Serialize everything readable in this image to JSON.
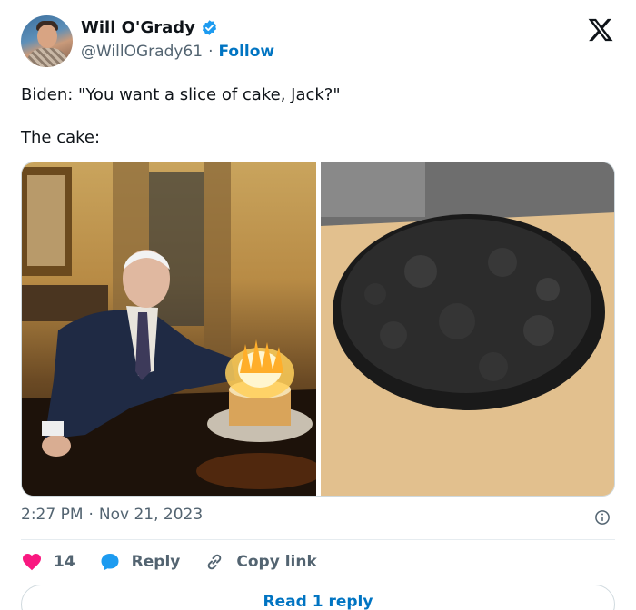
{
  "author": {
    "name": "Will O'Grady",
    "handle": "@WillOGrady61",
    "separator": "·",
    "follow_label": "Follow",
    "verified": true,
    "avatar_icon": "profile-photo"
  },
  "platform_icon": "x-logo-icon",
  "tweet": {
    "line1": "Biden: \"You want a slice of cake, Jack?\"",
    "line2": "The cake:"
  },
  "media": {
    "left_image": "photo-man-with-flaming-cake",
    "right_image": "photo-burnt-pizza"
  },
  "meta": {
    "time": "2:27 PM",
    "separator": "·",
    "date": "Nov 21, 2023",
    "info_icon": "info-icon"
  },
  "actions": {
    "like_count": "14",
    "reply_label": "Reply",
    "copy_label": "Copy link"
  },
  "read_replies_label": "Read 1 reply",
  "colors": {
    "text": "#0f1419",
    "muted": "#536471",
    "link": "#0074c2",
    "verified": "#1d9bf0",
    "like": "#f91880",
    "reply_icon": "#1d9bf0"
  }
}
